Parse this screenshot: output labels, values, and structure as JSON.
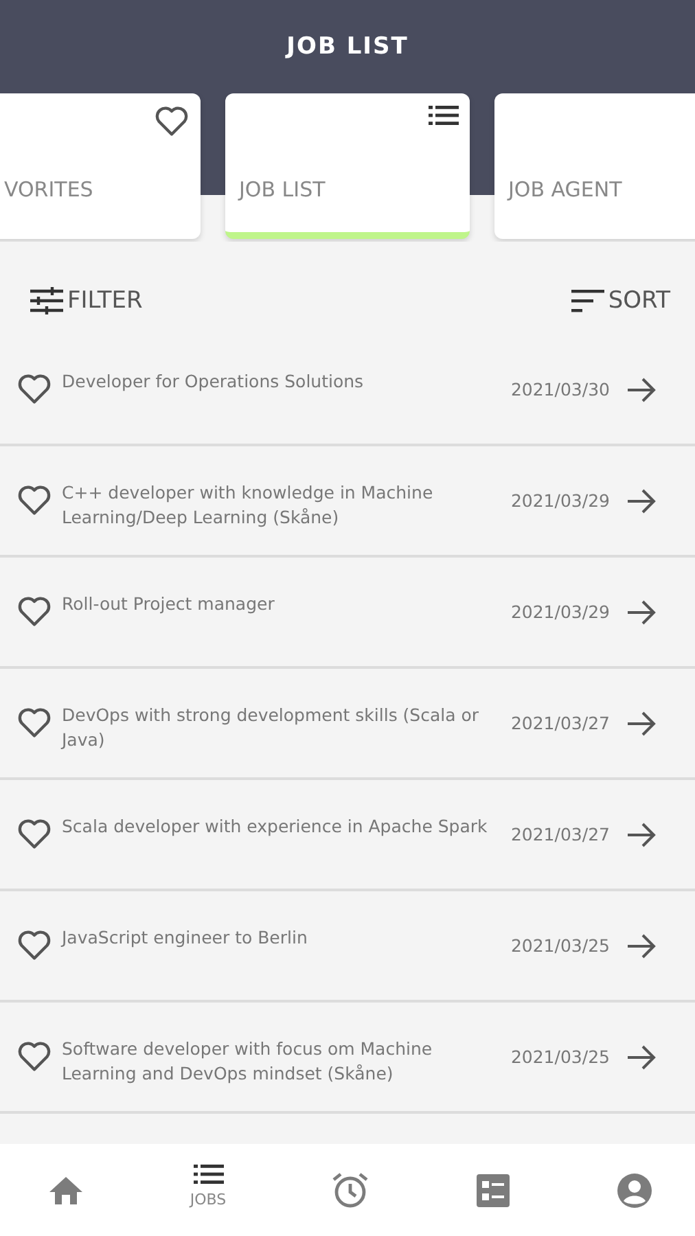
{
  "header": {
    "title": "JOB LIST"
  },
  "tabs": [
    {
      "label": "VORITES",
      "kind": "heart",
      "selected": false
    },
    {
      "label": "JOB LIST",
      "kind": "list",
      "selected": true
    },
    {
      "label": "JOB AGENT",
      "kind": "plain",
      "selected": false
    }
  ],
  "toolbar": {
    "filter": "FILTER",
    "sort": "SORT"
  },
  "jobs": [
    {
      "title": "Developer for Operations Solutions",
      "date": "2021/03/30",
      "favorite": false
    },
    {
      "title": "C++ developer with knowledge in Machine Learning/Deep Learning (Skåne)",
      "date": "2021/03/29",
      "favorite": false
    },
    {
      "title": "Roll-out Project manager",
      "date": "2021/03/29",
      "favorite": false
    },
    {
      "title": "DevOps with strong development skills (Scala or Java)",
      "date": "2021/03/27",
      "favorite": false
    },
    {
      "title": "Scala developer with experience in Apache Spark",
      "date": "2021/03/27",
      "favorite": false
    },
    {
      "title": "JavaScript engineer to Berlin",
      "date": "2021/03/25",
      "favorite": false
    },
    {
      "title": "Software developer with focus om Machine Learning and DevOps mindset (Skåne)",
      "date": "2021/03/25",
      "favorite": false
    }
  ],
  "bottom_nav": [
    {
      "kind": "home",
      "selected": false
    },
    {
      "kind": "list",
      "label": "JOBS",
      "selected": true
    },
    {
      "kind": "alarm",
      "selected": false
    },
    {
      "kind": "checklist",
      "selected": false
    },
    {
      "kind": "account",
      "selected": false
    }
  ]
}
